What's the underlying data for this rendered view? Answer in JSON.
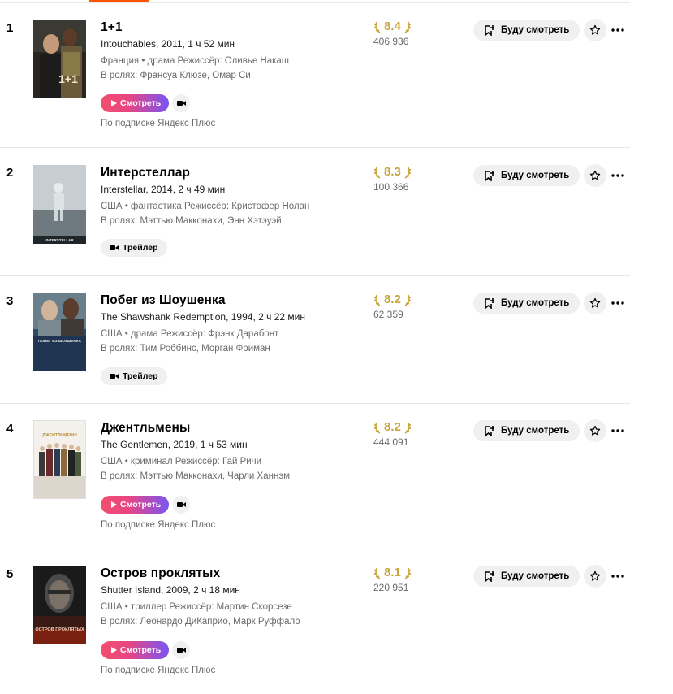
{
  "colors": {
    "accent": "#ff5500",
    "rating_gold": "#c9a43f",
    "watch_gradient_start": "#f24e6e",
    "watch_gradient_end": "#7a55f2"
  },
  "labels": {
    "watch_button": "Смотреть",
    "trailer_button": "Трейлер",
    "watchlist_button": "Буду смотреть",
    "subscription_note": "По подписке Яндекс Плюс"
  },
  "icons": {
    "play": "play-icon",
    "camera": "video-camera-icon",
    "watchlist": "bookmark-add-icon",
    "star": "star-icon",
    "more": "more-dots-icon",
    "laurel": "laurel-icon"
  },
  "movies": [
    {
      "rank": "1",
      "title": "1+1",
      "subtitle": "Intouchables, 2011, 1 ч 52 мин",
      "meta": "Франция • драма  Режиссёр: Оливье Накаш",
      "cast": "В ролях: Франсуа Клюзе, Омар Си",
      "rating": "8.4",
      "votes": "406 936",
      "availability": "watch",
      "poster_text": "1+1"
    },
    {
      "rank": "2",
      "title": "Интерстеллар",
      "subtitle": "Interstellar, 2014, 2 ч 49 мин",
      "meta": "США • фантастика  Режиссёр: Кристофер Нолан",
      "cast": "В ролях: Мэттью Макконахи, Энн Хэтэуэй",
      "rating": "8.3",
      "votes": "100 366",
      "availability": "trailer",
      "poster_text": "INTERSTELLAR"
    },
    {
      "rank": "3",
      "title": "Побег из Шоушенка",
      "subtitle": "The Shawshank Redemption, 1994, 2 ч 22 мин",
      "meta": "США • драма  Режиссёр: Фрэнк Дарабонт",
      "cast": "В ролях: Тим Роббинс, Морган Фриман",
      "rating": "8.2",
      "votes": "62 359",
      "availability": "trailer",
      "poster_text": "ПОБЕГ ИЗ ШОУШЕНКА"
    },
    {
      "rank": "4",
      "title": "Джентльмены",
      "subtitle": "The Gentlemen, 2019, 1 ч 53 мин",
      "meta": "США • криминал  Режиссёр: Гай Ричи",
      "cast": "В ролях: Мэттью Макконахи, Чарли Ханнэм",
      "rating": "8.2",
      "votes": "444 091",
      "availability": "watch",
      "poster_text": "ДЖЕНТЛЬМЕНЫ"
    },
    {
      "rank": "5",
      "title": "Остров проклятых",
      "subtitle": "Shutter Island, 2009, 2 ч 18 мин",
      "meta": "США • триллер  Режиссёр: Мартин Скорсезе",
      "cast": "В ролях: Леонардо ДиКаприо, Марк Руффало",
      "rating": "8.1",
      "votes": "220 951",
      "availability": "watch",
      "poster_text": "ОСТРОВ ПРОКЛЯТЫХ"
    }
  ]
}
